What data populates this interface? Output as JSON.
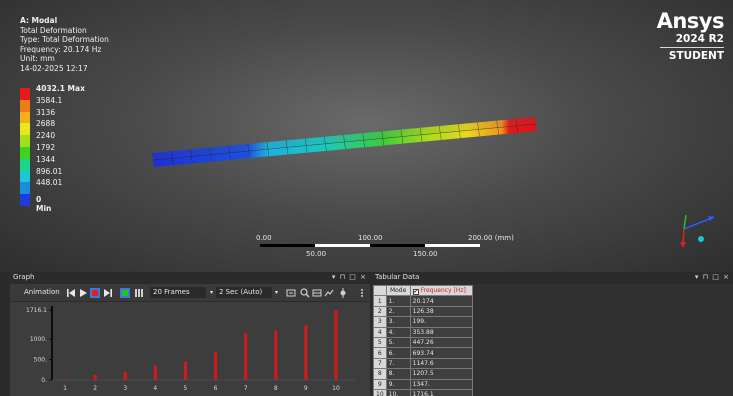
{
  "result": {
    "title": "A: Modal",
    "type_line": "Total Deformation",
    "subtype": "Type: Total Deformation",
    "frequency": "Frequency: 20.174 Hz",
    "unit": "Unit: mm",
    "date": "14-02-2025 12:17"
  },
  "legend": {
    "max_label": "4032.1 Max",
    "min_label": "0 Min",
    "labels": [
      "3584.1",
      "3136",
      "2688",
      "2240",
      "1792",
      "1344",
      "896.01",
      "448.01"
    ],
    "colors": [
      "#e41a1c",
      "#f0791c",
      "#f3b01c",
      "#e8e81c",
      "#a3e01c",
      "#3fd41c",
      "#1cd48a",
      "#1cc8d8",
      "#1c8ce0",
      "#1c3ce0"
    ]
  },
  "brand": {
    "name": "Ansys",
    "version": "2024 R2",
    "edition": "STUDENT"
  },
  "scale": {
    "t0": "0.00",
    "t100": "100.00",
    "t200": "200.00 (mm)",
    "t50": "50.00",
    "t150": "150.00"
  },
  "graph": {
    "title": "Graph",
    "controls": "▾ ⊓ □ ×",
    "animation_label": "Animation",
    "frames": "20 Frames",
    "duration": "2 Sec (Auto)"
  },
  "tabular": {
    "title": "Tabular Data",
    "controls": "▾ ⊓ □ ×",
    "col_mode": "Mode",
    "col_freq": "Frequency [Hz]",
    "rows": [
      {
        "idx": "1",
        "mode": "1.",
        "freq": "20.174"
      },
      {
        "idx": "2",
        "mode": "2.",
        "freq": "126.38"
      },
      {
        "idx": "3",
        "mode": "3.",
        "freq": "199."
      },
      {
        "idx": "4",
        "mode": "4.",
        "freq": "353.88"
      },
      {
        "idx": "5",
        "mode": "5.",
        "freq": "447.26"
      },
      {
        "idx": "6",
        "mode": "6.",
        "freq": "693.74"
      },
      {
        "idx": "7",
        "mode": "7.",
        "freq": "1147.6"
      },
      {
        "idx": "8",
        "mode": "8.",
        "freq": "1207.5"
      },
      {
        "idx": "9",
        "mode": "9.",
        "freq": "1347."
      },
      {
        "idx": "10",
        "mode": "10.",
        "freq": "1716.1"
      }
    ]
  },
  "chart_data": {
    "type": "bar",
    "categories": [
      "1",
      "2",
      "3",
      "4",
      "5",
      "6",
      "7",
      "8",
      "9",
      "10"
    ],
    "values": [
      20.174,
      126.38,
      199.0,
      353.88,
      447.26,
      693.74,
      1147.6,
      1207.5,
      1347.0,
      1716.1
    ],
    "ytick_labels": [
      "1716.1",
      "1000.",
      "500.",
      "0."
    ],
    "ylabel": "",
    "xlabel": "",
    "ylim": [
      0,
      1716.1
    ],
    "bar_color": "#cc1b1b"
  }
}
